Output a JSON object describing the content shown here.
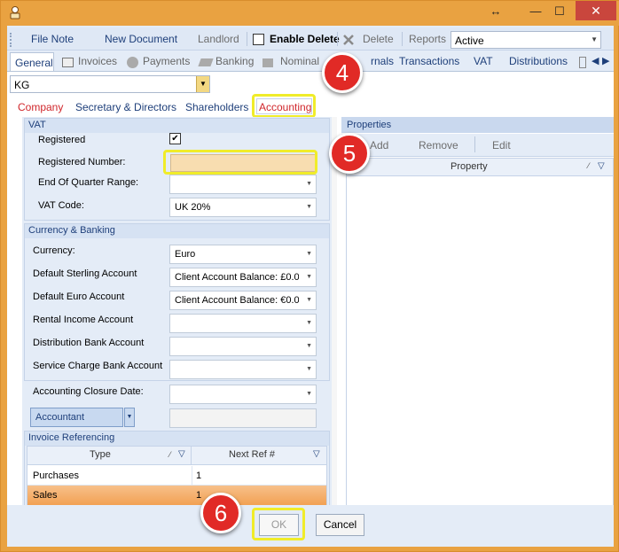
{
  "titlebar": {
    "resize_glyph": "↔",
    "minimize": "—",
    "maximize": "☐",
    "close": "✕"
  },
  "toolbar": {
    "file_note": "File Note",
    "new_document": "New Document",
    "landlord": "Landlord",
    "enable_delete": "Enable Delete",
    "delete": "Delete",
    "reports": "Reports",
    "reports_value": "Active"
  },
  "tabs": [
    "General",
    "Invoices",
    "Payments",
    "Banking",
    "Nominal",
    "Journals",
    "Transactions",
    "VAT",
    "Distributions"
  ],
  "tab_journals_visible": "rnals",
  "entity_select": "KG",
  "subtabs": [
    "Company",
    "Secretary & Directors",
    "Shareholders",
    "Accounting"
  ],
  "vat": {
    "title": "VAT",
    "registered_label": "Registered",
    "registered_checked": true,
    "check_glyph": "✔",
    "reg_number_label": "Registered Number:",
    "reg_number_value": "",
    "quarter_label": "End Of Quarter Range:",
    "quarter_value": "",
    "code_label": "VAT Code:",
    "code_value": "UK 20%"
  },
  "currency": {
    "title": "Currency & Banking",
    "currency_label": "Currency:",
    "currency_value": "Euro",
    "sterling_label": "Default Sterling Account",
    "sterling_value": "Client Account  Balance: £0.0",
    "euro_label": "Default Euro Account",
    "euro_value": "Client Account  Balance: €0.0",
    "rental_label": "Rental Income Account",
    "distribution_label": "Distribution Bank Account",
    "service_label": "Service Charge Bank Account"
  },
  "closure_label": "Accounting Closure Date:",
  "accountant_label": "Accountant",
  "invoice_ref": {
    "title": "Invoice Referencing",
    "columns": [
      "Type",
      "Next Ref #"
    ],
    "rows": [
      {
        "type": "Purchases",
        "next": "1"
      },
      {
        "type": "Sales",
        "next": "1"
      }
    ]
  },
  "properties": {
    "title": "Properties",
    "add": "Add",
    "remove": "Remove",
    "edit": "Edit",
    "column": "Property"
  },
  "footer": {
    "ok": "OK",
    "cancel": "Cancel"
  },
  "badges": [
    "4",
    "5",
    "6"
  ],
  "colors": {
    "titlebar": "#e9a241",
    "highlight": "#f0ec2a",
    "badge": "#e12a26",
    "selected_row": "#f2a153"
  }
}
